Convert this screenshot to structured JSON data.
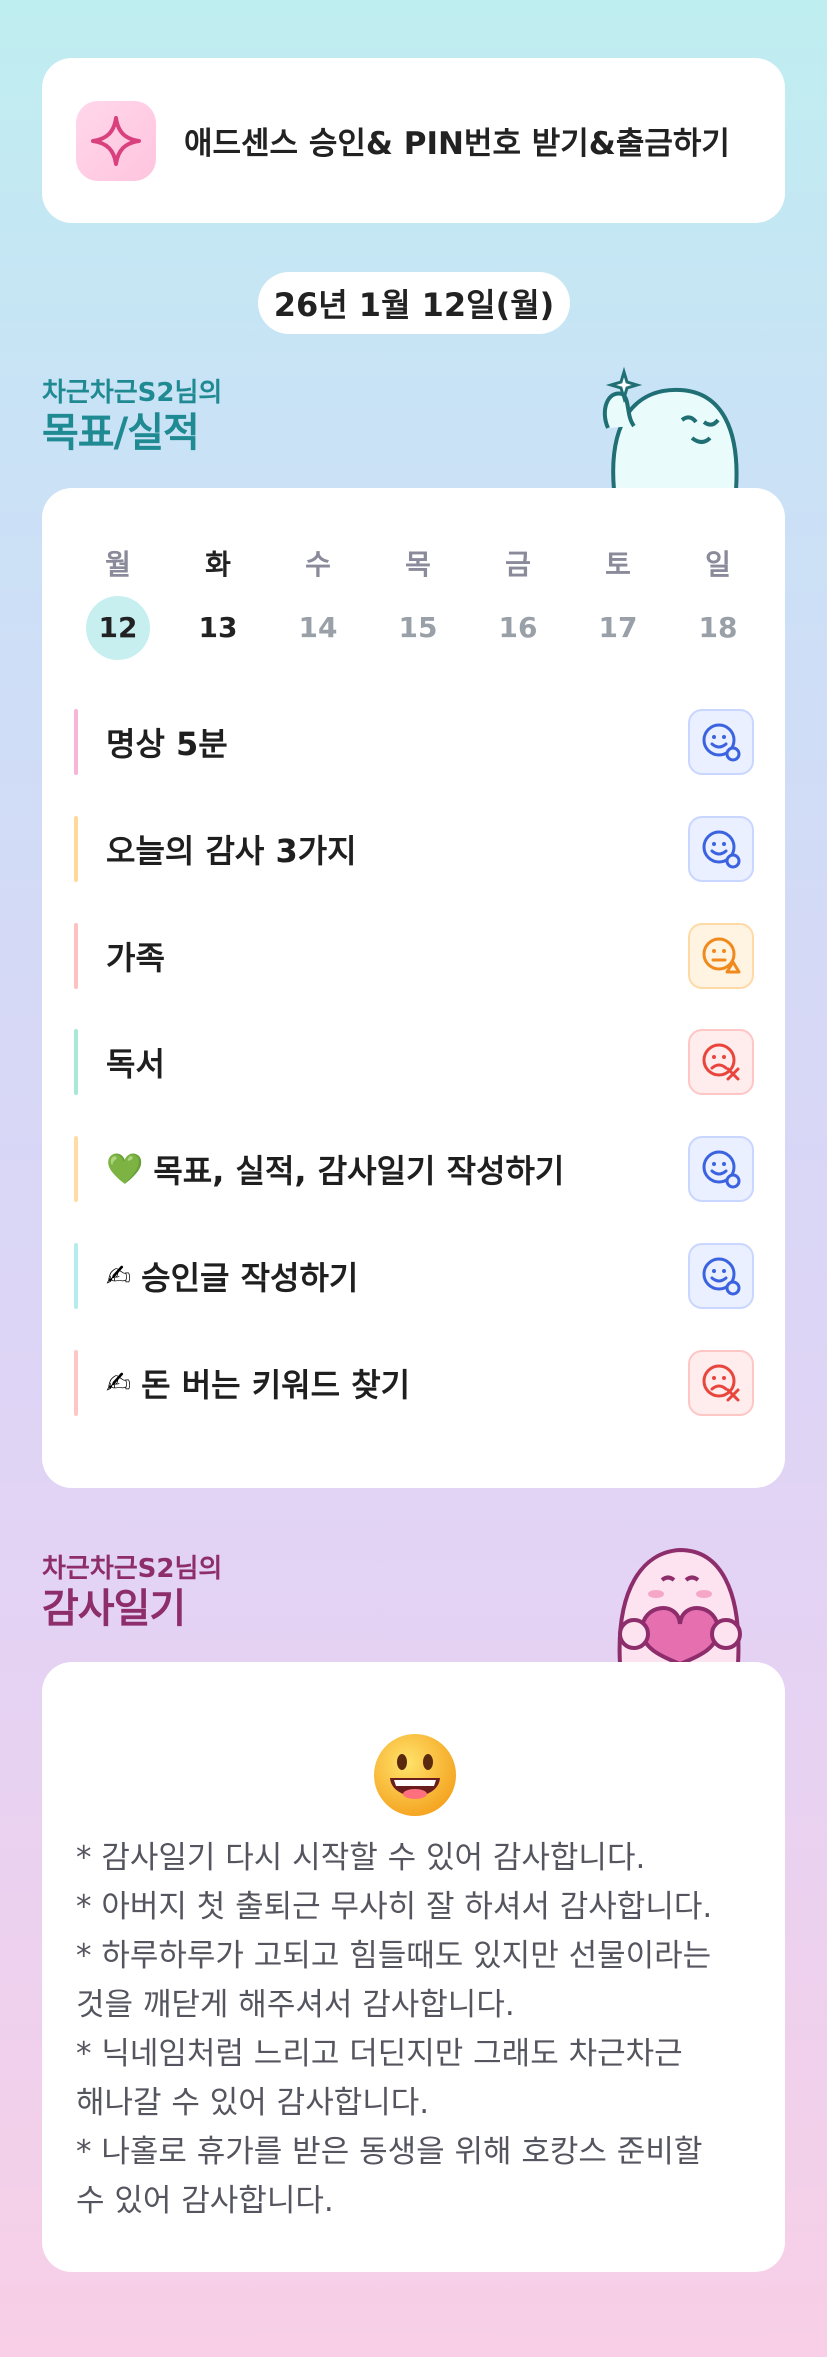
{
  "banner": {
    "title": "애드센스 승인& PIN번호 받기&출금하기",
    "icon": "sparkle-icon"
  },
  "date": "26년 1월 12일(월)",
  "goals_section": {
    "subtitle": "차근차근S2님의",
    "title": "목표/실적"
  },
  "calendar": {
    "weekdays": [
      "월",
      "화",
      "수",
      "목",
      "금",
      "토",
      "일"
    ],
    "days": [
      "12",
      "13",
      "14",
      "15",
      "16",
      "17",
      "18"
    ],
    "selected_index": 0
  },
  "tasks": [
    {
      "label": "명상 5분",
      "emoji": "",
      "bar_color": "#f7b6d6",
      "status": "blue",
      "status_icon": "smile-check-icon"
    },
    {
      "label": "오늘의 감사 3가지",
      "emoji": "",
      "bar_color": "#ffd99a",
      "status": "blue",
      "status_icon": "smile-check-icon"
    },
    {
      "label": "가족",
      "emoji": "",
      "bar_color": "#ffc0c0",
      "status": "orange",
      "status_icon": "meh-warning-icon"
    },
    {
      "label": "독서",
      "emoji": "",
      "bar_color": "#a8e8d8",
      "status": "red",
      "status_icon": "sad-x-icon"
    },
    {
      "label": "목표, 실적, 감사일기 작성하기",
      "emoji": "💚",
      "bar_color": "#ffdca6",
      "status": "blue",
      "status_icon": "smile-check-icon"
    },
    {
      "label": "승인글 작성하기",
      "emoji": "✍",
      "bar_color": "#b7ecef",
      "status": "blue",
      "status_icon": "smile-check-icon"
    },
    {
      "label": "돈 버는 키워드 찾기",
      "emoji": "✍",
      "bar_color": "#ffc6c6",
      "status": "red",
      "status_icon": "sad-x-icon"
    }
  ],
  "diary_section": {
    "subtitle": "차근차근S2님의",
    "title": "감사일기"
  },
  "diary": {
    "emoji": "grinning-face-icon",
    "lines": [
      "* 감사일기 다시 시작할 수 있어 감사합니다.",
      "* 아버지 첫 출퇴근 무사히 잘 하셔서 감사합니다.",
      "* 하루하루가 고되고 힘들때도 있지만 선물이라는",
      "것을 깨닫게 해주셔서 감사합니다.",
      "* 닉네임처럼 느리고 더딘지만 그래도 차근차근",
      "해나갈 수 있어 감사합니다.",
      "* 나홀로 휴가를 받은 동생을 위해 호캉스 준비할",
      "수 있어 감사합니다."
    ]
  },
  "colors": {
    "goals_heading": "#1f8a92",
    "diary_heading": "#8e2d6c",
    "today_bg": "#c7eff0"
  }
}
